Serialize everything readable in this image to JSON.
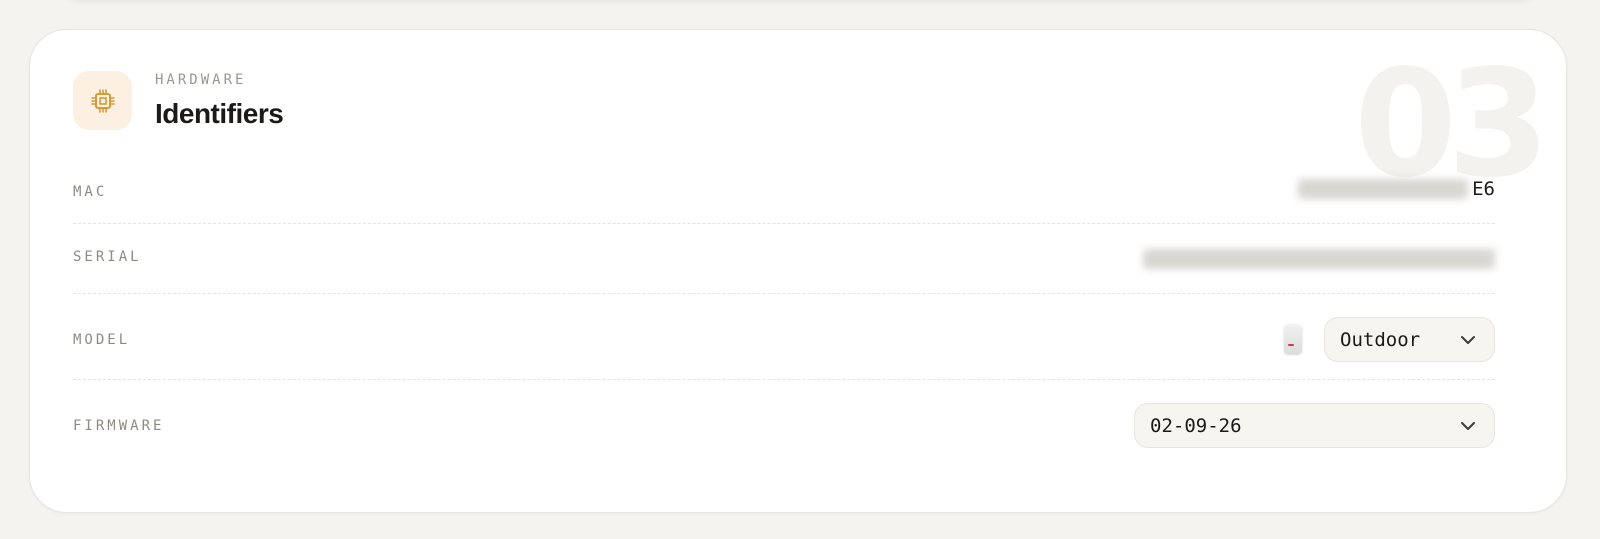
{
  "card": {
    "eyebrow": "HARDWARE",
    "title": "Identifiers",
    "watermark": "03",
    "icon": "chip-icon",
    "accent_color": "#d49b3a"
  },
  "rows": {
    "mac": {
      "label": "MAC",
      "value_visible": "E6"
    },
    "serial": {
      "label": "SERIAL"
    },
    "model": {
      "label": "MODEL",
      "selected": "Outdoor"
    },
    "firmware": {
      "label": "FIRMWARE",
      "selected": "02-09-26"
    }
  }
}
